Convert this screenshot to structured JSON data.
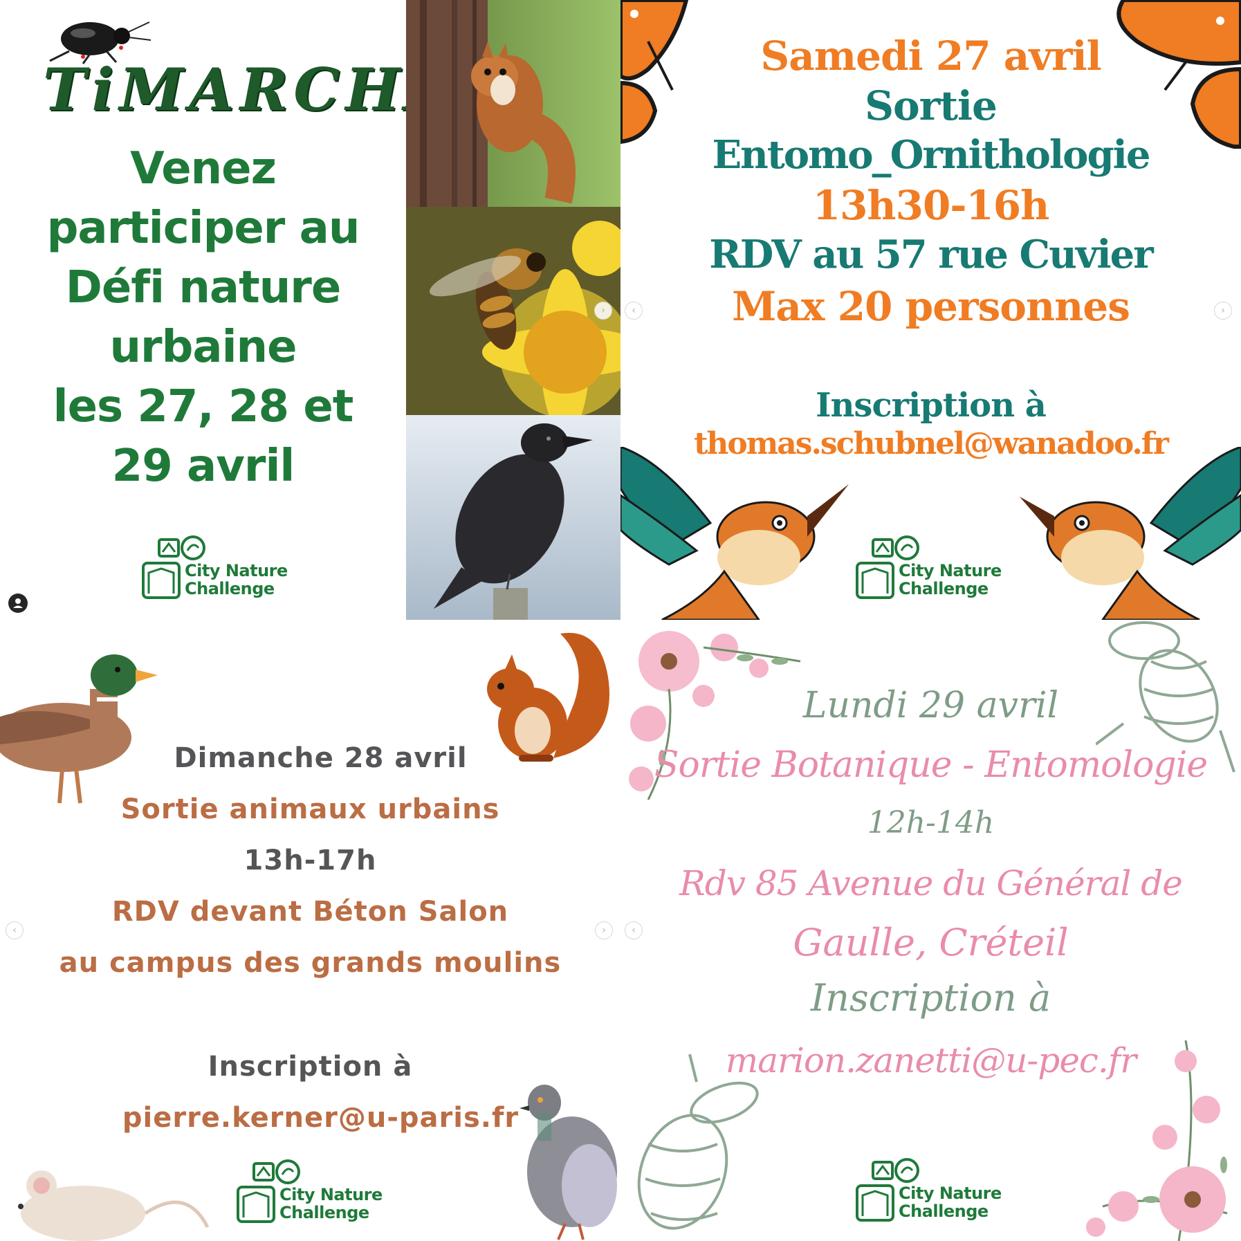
{
  "panel1": {
    "brand": "TiMARCHA",
    "lines": [
      "Venez",
      "participer au",
      "Défi nature",
      "urbaine",
      "les 27, 28 et",
      "29 avril"
    ]
  },
  "panel2": {
    "date": "Samedi 27 avril",
    "sortie": "Sortie",
    "theme": "Entomo_Ornithologie",
    "time": "13h30-16h",
    "rdv": "RDV au 57 rue Cuvier",
    "max": "Max 20 personnes",
    "inscription": "Inscription à",
    "email": "thomas.schubnel@wanadoo.fr"
  },
  "panel3": {
    "date": "Dimanche 28 avril",
    "sortie": "Sortie animaux urbains",
    "time": "13h-17h",
    "rdv": "RDV devant Béton Salon",
    "place": "au campus des grands moulins",
    "inscription": "Inscription à",
    "email": "pierre.kerner@u-paris.fr"
  },
  "panel4": {
    "date": "Lundi 29 avril",
    "sortie": "Sortie Botanique - Entomologie",
    "time": "12h-14h",
    "rdv1": "Rdv 85 Avenue du Général de",
    "rdv2": "Gaulle, Créteil",
    "inscription": "Inscription à",
    "email": "marion.zanetti@u-pec.fr"
  },
  "logo": {
    "line1": "City Nature",
    "line2": "Challenge"
  },
  "nav": {
    "prev": "‹",
    "next": "›"
  },
  "colors": {
    "green": "#1f7a3a",
    "orange": "#f07c23",
    "teal": "#177a73",
    "grey": "#555558",
    "brown": "#bb6d44",
    "sage": "#7f9c86",
    "pink": "#e98cab"
  }
}
